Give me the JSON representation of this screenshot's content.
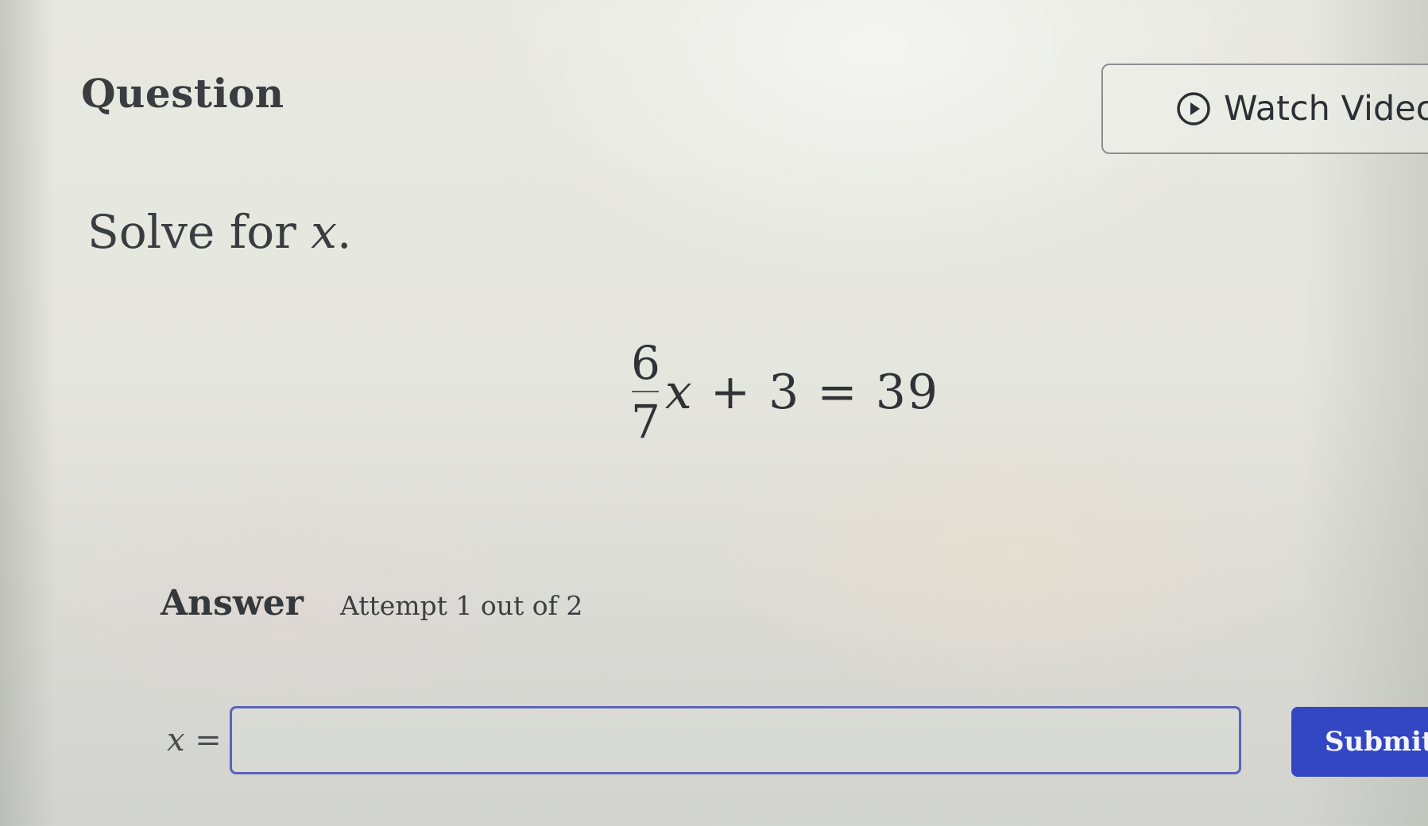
{
  "header": {
    "title": "Question",
    "watch_video_label": "Watch Video",
    "watch_video_icon": "play-circle-icon"
  },
  "problem": {
    "instruction_text": "Solve for ",
    "instruction_var": "x",
    "instruction_end": ".",
    "equation": {
      "numerator": "6",
      "denominator": "7",
      "rest_var": "x",
      "rest_text": " + 3 = 39"
    }
  },
  "answer": {
    "label": "Answer",
    "attempt_text": "Attempt 1 out of 2",
    "input_prefix": "x =",
    "input_value": "",
    "submit_label": "Submit"
  },
  "colors": {
    "submit_bg": "#3347c4",
    "input_border": "#5b63b8",
    "background": "#e6e7df"
  }
}
